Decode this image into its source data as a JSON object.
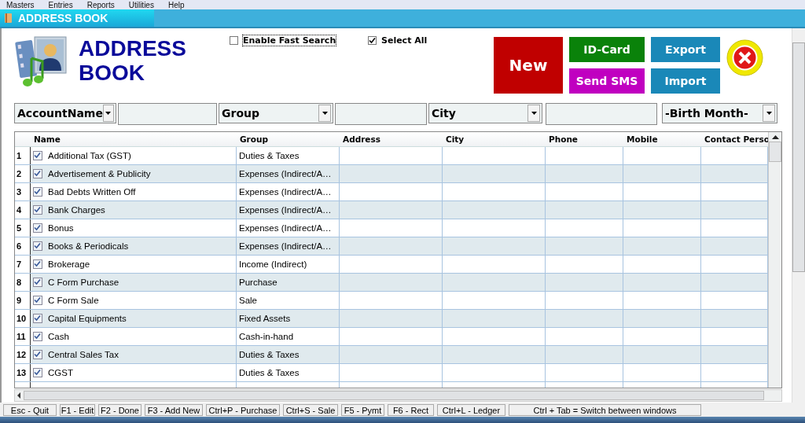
{
  "menu": [
    "Masters",
    "Entries",
    "Reports",
    "Utilities",
    "Help"
  ],
  "window": {
    "title": "ADDRESS BOOK"
  },
  "heading": "ADDRESS BOOK",
  "options": [
    {
      "label": "Enable Fast Search",
      "checked": false,
      "focused": true
    },
    {
      "label": "Select All",
      "checked": true,
      "focused": false
    }
  ],
  "buttons": [
    {
      "label": "New",
      "kind": "big",
      "color": "#c00000"
    },
    {
      "label": "ID-Card",
      "kind": "small",
      "color": "#0a820a"
    },
    {
      "label": "Send SMS",
      "kind": "small",
      "color": "#c000c0"
    },
    {
      "label": "Export",
      "kind": "small",
      "color": "#1a88b8"
    },
    {
      "label": "Import",
      "kind": "small",
      "color": "#1a88b8"
    }
  ],
  "filters": [
    {
      "kind": "combo",
      "value": "AccountName"
    },
    {
      "kind": "field"
    },
    {
      "kind": "combo",
      "value": "Group"
    },
    {
      "kind": "field"
    },
    {
      "kind": "combo",
      "value": "City"
    },
    {
      "kind": "field"
    },
    {
      "kind": "combo",
      "value": "-Birth Month-"
    }
  ],
  "table": {
    "columns": [
      "Name",
      "Group",
      "Address",
      "City",
      "Phone",
      "Mobile",
      "Contact Perso"
    ],
    "rows": [
      {
        "num": "1",
        "checked": true,
        "name": "Additional Tax (GST)",
        "group": "Duties & Taxes"
      },
      {
        "num": "2",
        "checked": true,
        "name": "Advertisement & Publicity",
        "group": "Expenses (Indirect/A…"
      },
      {
        "num": "3",
        "checked": true,
        "name": "Bad Debts Written Off",
        "group": "Expenses (Indirect/A…"
      },
      {
        "num": "4",
        "checked": true,
        "name": "Bank Charges",
        "group": "Expenses (Indirect/A…"
      },
      {
        "num": "5",
        "checked": true,
        "name": "Bonus",
        "group": "Expenses (Indirect/A…"
      },
      {
        "num": "6",
        "checked": true,
        "name": "Books & Periodicals",
        "group": "Expenses (Indirect/A…"
      },
      {
        "num": "7",
        "checked": true,
        "name": "Brokerage",
        "group": "Income (Indirect)"
      },
      {
        "num": "8",
        "checked": true,
        "name": "C Form Purchase",
        "group": "Purchase"
      },
      {
        "num": "9",
        "checked": true,
        "name": "C Form Sale",
        "group": "Sale"
      },
      {
        "num": "10",
        "checked": true,
        "name": "Capital Equipments",
        "group": "Fixed Assets"
      },
      {
        "num": "11",
        "checked": true,
        "name": "Cash",
        "group": "Cash-in-hand"
      },
      {
        "num": "12",
        "checked": true,
        "name": "Central Sales Tax",
        "group": "Duties & Taxes"
      },
      {
        "num": "13",
        "checked": true,
        "name": "CGST",
        "group": "Duties & Taxes"
      }
    ]
  },
  "status_bar": [
    "Esc - Quit",
    "F1 - Edit",
    "F2 - Done",
    "F3 - Add New",
    "Ctrl+P - Purchase",
    "Ctrl+S - Sale",
    "F5 - Pymt",
    "F6 - Rect",
    "Ctrl+L - Ledger",
    "Ctrl + Tab = Switch between windows"
  ]
}
